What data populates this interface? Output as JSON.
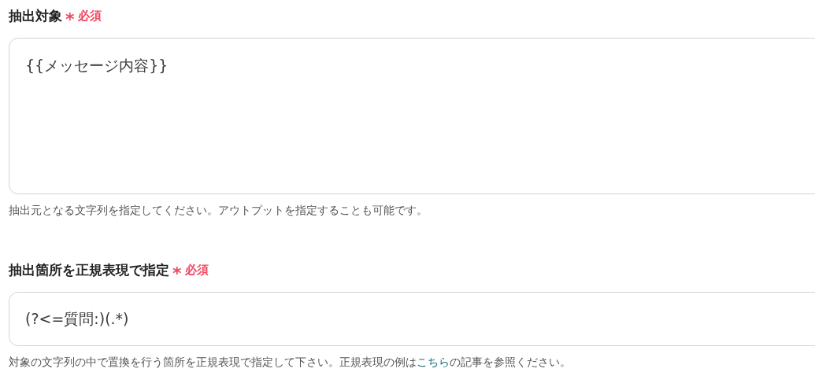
{
  "fields": [
    {
      "label": "抽出対象",
      "required": true,
      "required_mark": "*",
      "required_label": "必須",
      "kind": "textarea",
      "value": "{{メッセージ内容}}",
      "help": {
        "before": "抽出元となる文字列を指定してください。アウトプットを指定することも可能です。"
      }
    },
    {
      "label": "抽出箇所を正規表現で指定",
      "required": true,
      "required_mark": "*",
      "required_label": "必須",
      "kind": "input",
      "value": "(?<=質問:)(.*)",
      "help": {
        "before": "対象の文字列の中で置換を行う箇所を正規表現で指定して下さい。正規表現の例は",
        "link": "こちら",
        "after": "の記事を参照ください。"
      }
    }
  ]
}
